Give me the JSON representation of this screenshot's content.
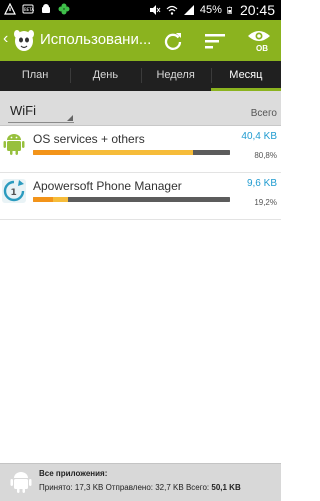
{
  "status": {
    "battery": "45%",
    "time": "20:45"
  },
  "header": {
    "title": "Использовани...",
    "ov_label": "OB"
  },
  "tabs": [
    {
      "label": "План"
    },
    {
      "label": "День"
    },
    {
      "label": "Неделя"
    },
    {
      "label": "Месяц",
      "active": true
    }
  ],
  "filter": {
    "network": "WiFi",
    "total_label": "Всего"
  },
  "apps": [
    {
      "name": "OS services + others",
      "size": "40,4 KB",
      "percent": "80,8%",
      "usage": {
        "orange": 0.19,
        "yellow": 0.62,
        "gray": 0.19
      }
    },
    {
      "name": "Apowersoft Phone Manager",
      "size": "9,6 KB",
      "percent": "19,2%",
      "usage": {
        "orange": 0.1,
        "yellow": 0.08,
        "gray": 0.82
      }
    }
  ],
  "footer": {
    "title": "Все приложения:",
    "received_label": "Принято:",
    "received": "17,3 KB",
    "sent_label": "Отправлено:",
    "sent": "32,7 KB",
    "total_label": "Всего:",
    "total": "50,1 KB"
  },
  "colors": {
    "accent": "#8bb31f",
    "link": "#1f9bd0",
    "orange": "#f39419",
    "yellow": "#f6bc3a",
    "gray": "#5c5c5c"
  }
}
